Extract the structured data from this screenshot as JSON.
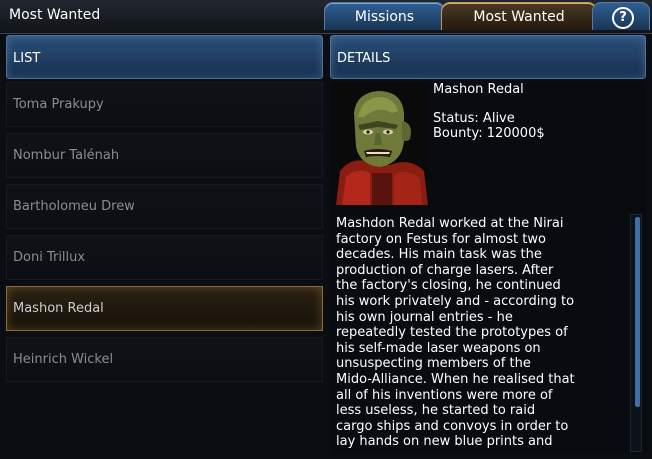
{
  "window": {
    "title": "Most Wanted"
  },
  "tabs": [
    {
      "label": "Missions"
    },
    {
      "label": "Most Wanted"
    },
    {
      "label": "?"
    }
  ],
  "list_panel": {
    "header": "LIST",
    "items": [
      {
        "name": "Toma Prakupy"
      },
      {
        "name": "Nombur Talénah"
      },
      {
        "name": "Bartholomeu Drew"
      },
      {
        "name": "Doni Trillux"
      },
      {
        "name": "Mashon Redal",
        "selected": true
      },
      {
        "name": "Heinrich Wickel"
      }
    ]
  },
  "details_panel": {
    "header": "DETAILS",
    "name": "Mashon Redal",
    "status": "Status: Alive",
    "bounty": "Bounty: 120000$",
    "bio_lines": [
      "Mashdon Redal worked at the Nirai",
      "factory on Festus for almost two",
      "decades. His main task was the",
      "production of charge lasers. After",
      "the factory's closing, he continued",
      "his work privately and - according to",
      "his own journal entries - he",
      "repeatedly tested the prototypes of",
      "his self-made laser weapons on",
      "unsuspecting members of the",
      "Mido-Alliance. When he realised that",
      "all of his inventions were more of",
      "less useless, he started to raid",
      "cargo ships and convoys in order to",
      "lay hands on new blue prints and"
    ]
  }
}
